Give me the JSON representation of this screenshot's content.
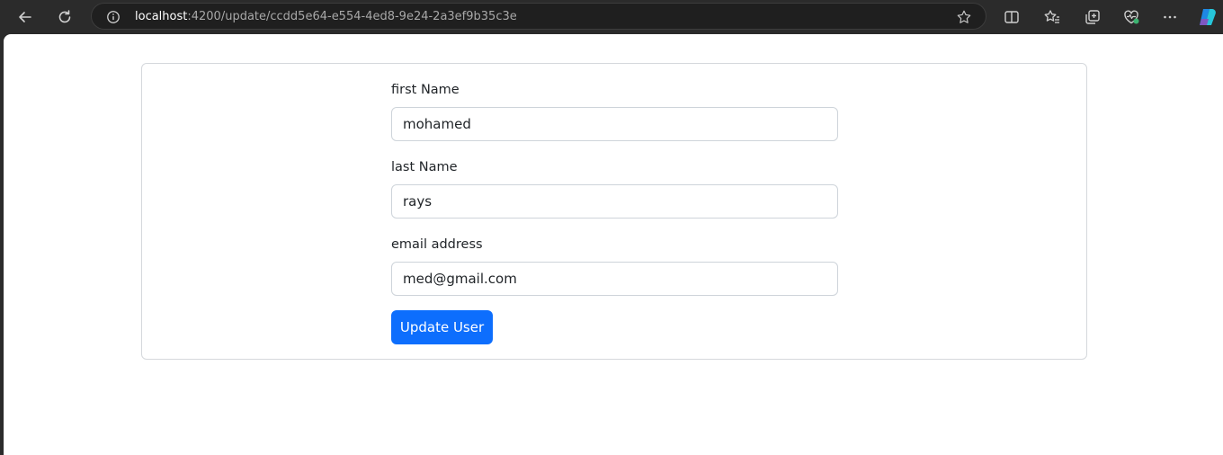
{
  "browser": {
    "url_host": "localhost",
    "url_rest": ":4200/update/ccdd5e64-e554-4ed8-9e24-2a3ef9b35c3e",
    "icons": [
      "back-arrow-icon",
      "refresh-icon",
      "site-info-icon",
      "favorite-star-icon",
      "split-screen-icon",
      "favorites-icon",
      "collections-icon",
      "browser-essentials-icon",
      "more-menu-icon",
      "copilot-icon"
    ]
  },
  "form": {
    "first_name_label": "first Name",
    "first_name_value": "mohamed",
    "last_name_label": "last Name",
    "last_name_value": "rays",
    "email_label": "email address",
    "email_value": "med@gmail.com",
    "submit_label": "Update User"
  },
  "colors": {
    "button": "#0d6efd",
    "chrome": "#2b2b2b"
  }
}
